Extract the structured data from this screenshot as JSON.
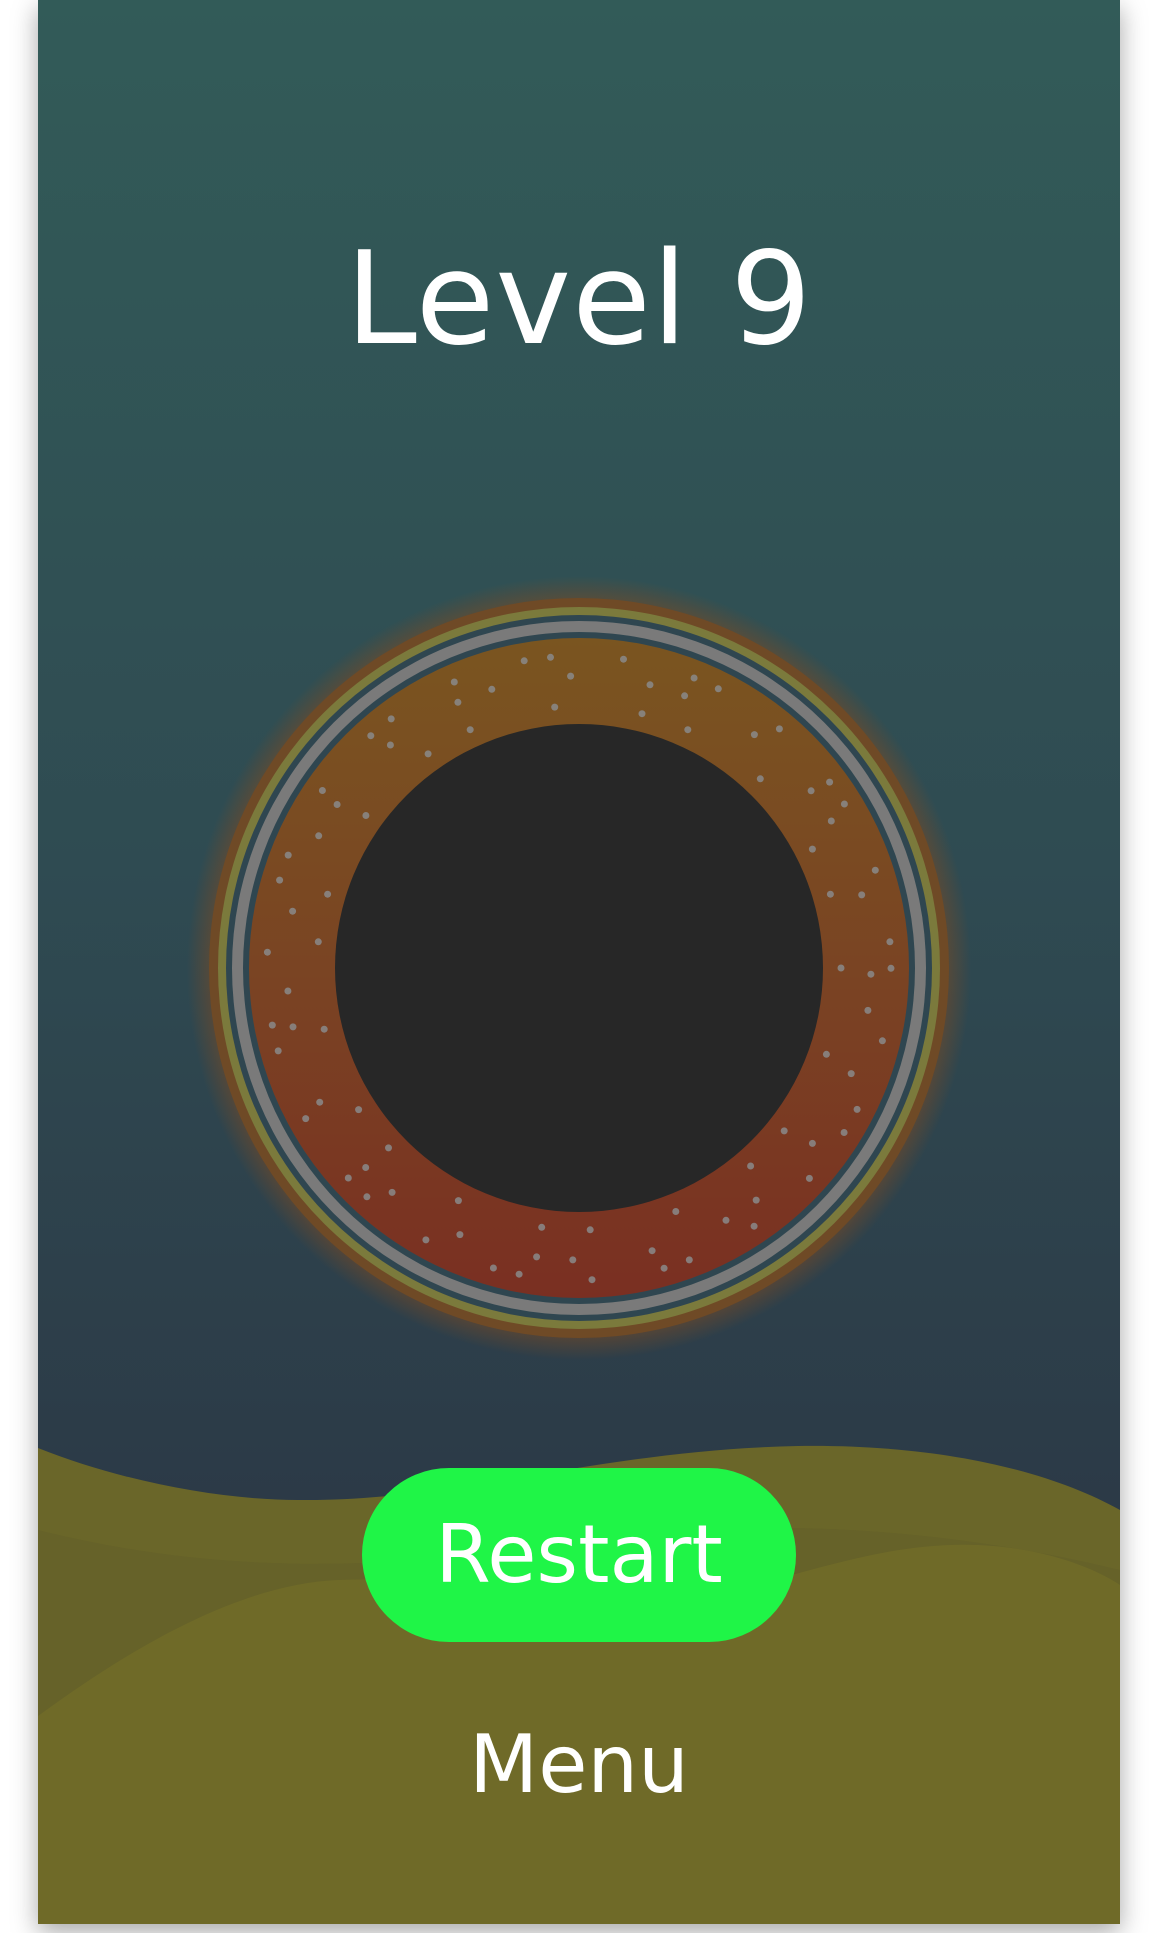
{
  "level_title": "Level 9",
  "buttons": {
    "restart_label": "Restart",
    "menu_label": "Menu"
  },
  "colors": {
    "background_top": "#325b58",
    "background_bottom": "#2b3444",
    "hills_back": "#696629",
    "hills_front": "#6f6a28",
    "ring_outer_glow": "#7a4a24",
    "ring_olive": "#7b7a3c",
    "ring_gray": "#7a7a7a",
    "ring_gradient_top": "#7a5520",
    "ring_gradient_bottom": "#7a2f22",
    "ring_dots": "#8a8a8a",
    "core": "#272727",
    "restart_button": "#1ff547",
    "text": "#ffffff"
  }
}
